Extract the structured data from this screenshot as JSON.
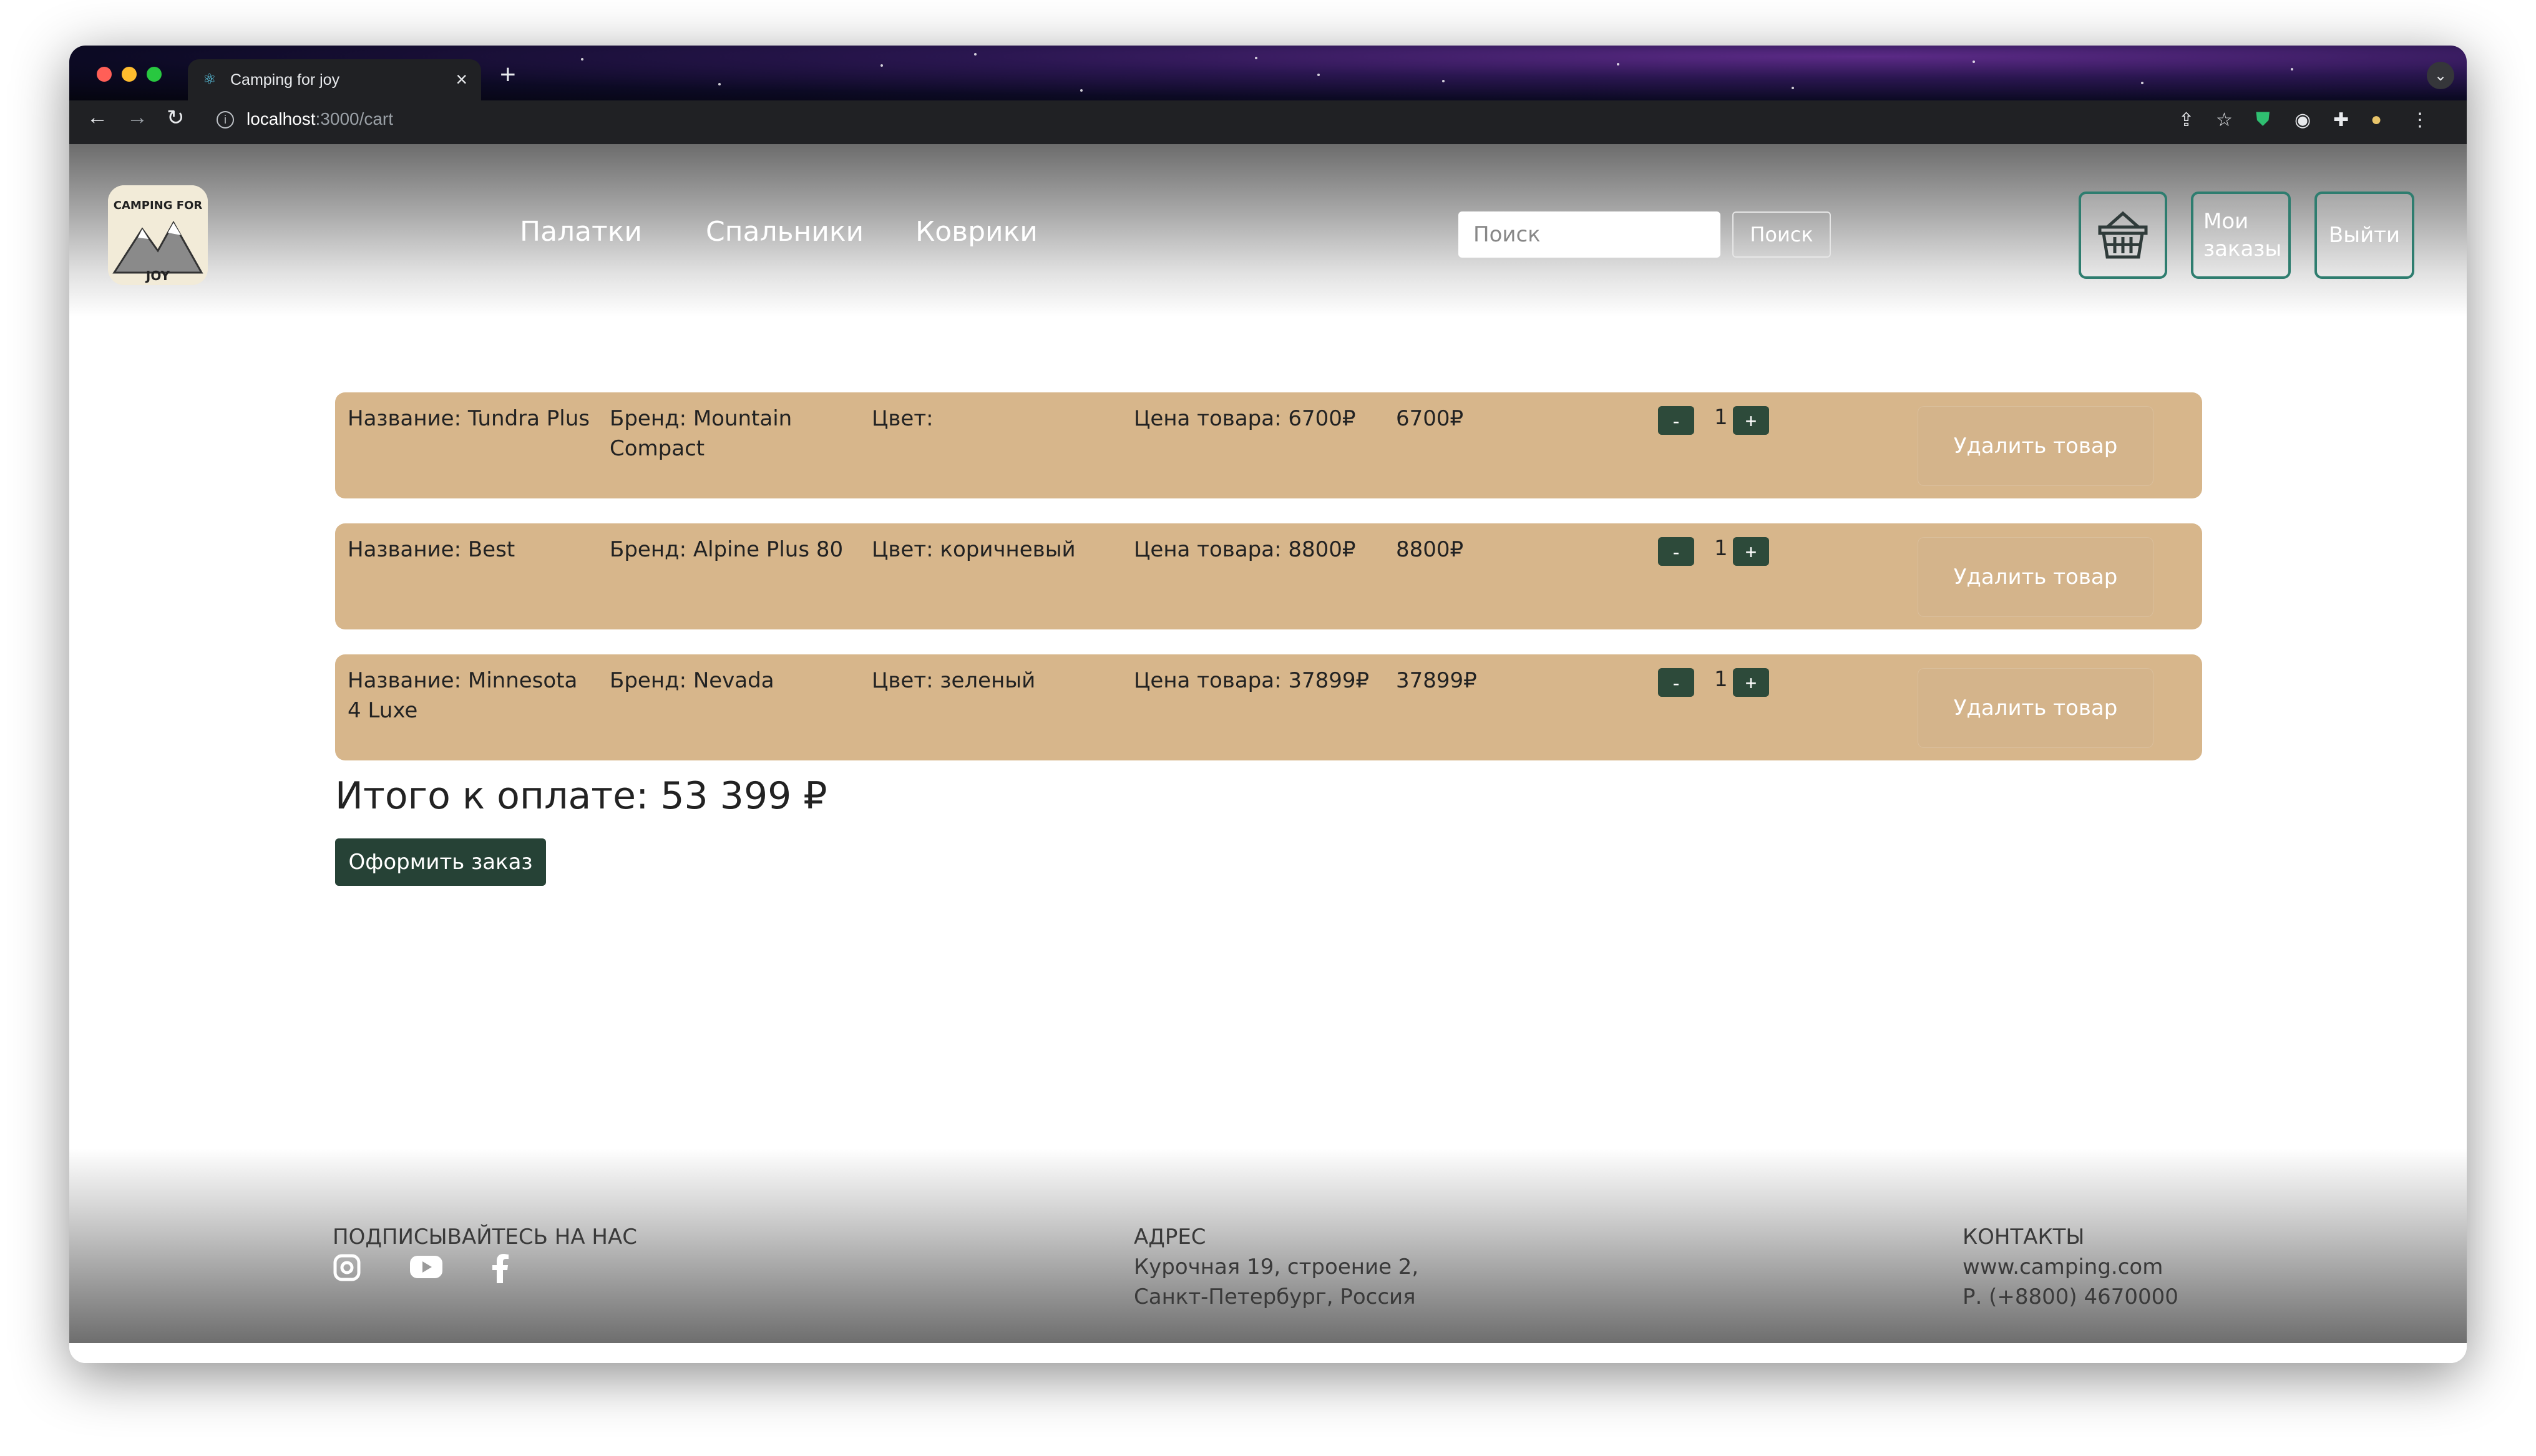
{
  "browser": {
    "tab_title": "Camping for joy",
    "tab_close": "×",
    "new_tab": "+",
    "url_host": "localhost",
    "url_path": ":3000/cart"
  },
  "header": {
    "logo_alt": "Camping for joy logo",
    "logo_text_top": "CAMPING FOR",
    "logo_text_bottom": "JOY",
    "nav": [
      "Палатки",
      "Спальники",
      "Коврики"
    ],
    "search_placeholder": "Поиск",
    "search_button": "Поиск",
    "my_orders": "Мои заказы",
    "logout": "Выйти"
  },
  "cart": {
    "items": [
      {
        "name": "Название: Tundra Plus",
        "brand": "Бренд: Mountain Compact",
        "color": "Цвет:",
        "unit_price": "Цена товара: 6700₽",
        "total": "6700₽",
        "qty": "1"
      },
      {
        "name": "Название: Best",
        "brand": "Бренд: Alpine Plus 80",
        "color": "Цвет: коричневый",
        "unit_price": "Цена товара: 8800₽",
        "total": "8800₽",
        "qty": "1"
      },
      {
        "name": "Название: Minnesota 4 Luxe",
        "brand": "Бренд: Nevada",
        "color": "Цвет: зеленый",
        "unit_price": "Цена товара: 37899₽",
        "total": "37899₽",
        "qty": "1"
      }
    ],
    "minus": "-",
    "plus": "+",
    "remove_label": "Удалить товар",
    "total_label": "Итого к оплате: 53 399 ₽",
    "checkout_label": "Оформить заказ"
  },
  "footer": {
    "subscribe_head": "ПОДПИСЫВАЙТЕСЬ НА НАС",
    "address_head": "АДРЕС",
    "address_line1": "Курочная 19, строение 2,",
    "address_line2": "Санкт-Петербург, Россия",
    "contacts_head": "КОНТАКТЫ",
    "contacts_site": "www.camping.com",
    "contacts_phone": "Р. (+8800) 4670000"
  }
}
